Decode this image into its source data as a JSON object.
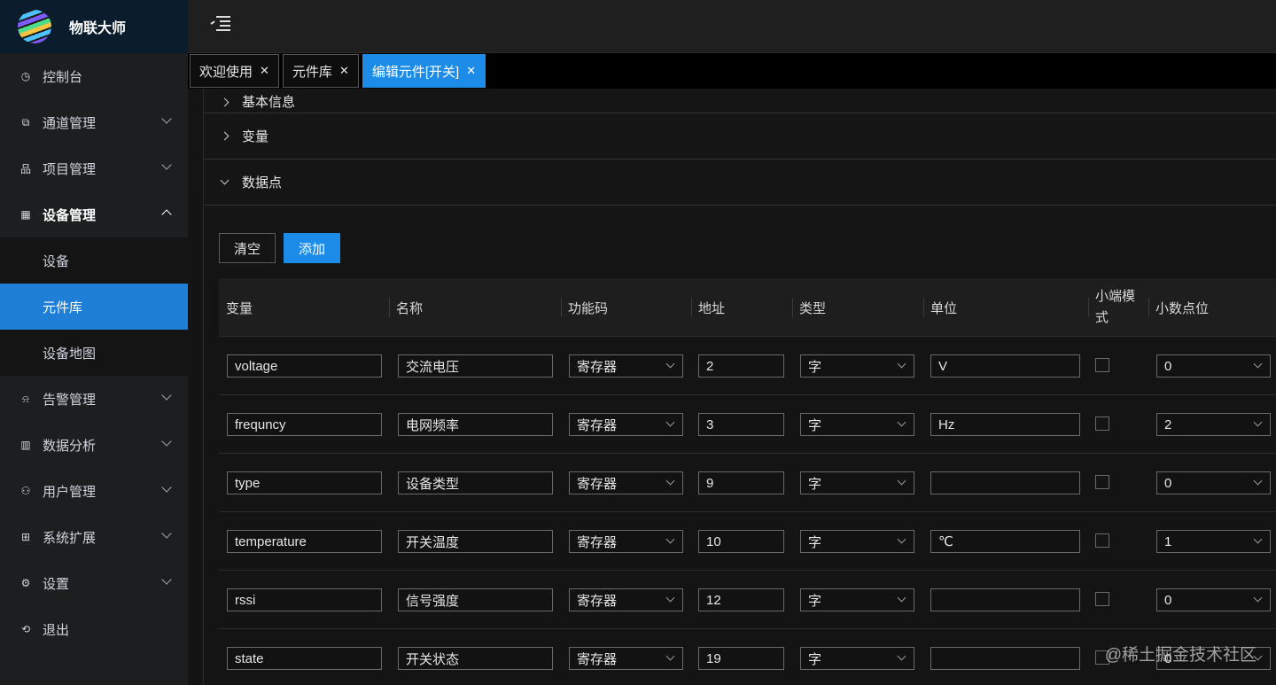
{
  "app": {
    "title": "物联大师"
  },
  "sidebar": {
    "items": [
      {
        "label": "控制台",
        "icon": "dashboard-icon",
        "glyph": "◷",
        "hasArrow": false
      },
      {
        "label": "通道管理",
        "icon": "channel-icon",
        "glyph": "⧉",
        "hasArrow": true
      },
      {
        "label": "项目管理",
        "icon": "project-icon",
        "glyph": "品",
        "hasArrow": true
      },
      {
        "label": "设备管理",
        "icon": "device-icon",
        "glyph": "▦",
        "hasArrow": true,
        "open": true,
        "children": [
          {
            "label": "设备",
            "active": false
          },
          {
            "label": "元件库",
            "active": true
          },
          {
            "label": "设备地图",
            "active": false
          }
        ]
      },
      {
        "label": "告警管理",
        "icon": "bell-icon",
        "glyph": "⍾",
        "hasArrow": true
      },
      {
        "label": "数据分析",
        "icon": "chart-icon",
        "glyph": "▥",
        "hasArrow": true
      },
      {
        "label": "用户管理",
        "icon": "user-icon",
        "glyph": "⚇",
        "hasArrow": true
      },
      {
        "label": "系统扩展",
        "icon": "extension-icon",
        "glyph": "⊞",
        "hasArrow": true
      },
      {
        "label": "设置",
        "icon": "gear-icon",
        "glyph": "⚙",
        "hasArrow": true
      },
      {
        "label": "退出",
        "icon": "logout-icon",
        "glyph": "⟲",
        "hasArrow": false
      }
    ]
  },
  "tabs": [
    {
      "label": "欢迎使用",
      "active": false
    },
    {
      "label": "元件库",
      "active": false
    },
    {
      "label": "编辑元件[开关]",
      "active": true
    }
  ],
  "sections": {
    "basic": "基本信息",
    "variables": "变量",
    "points": "数据点"
  },
  "buttons": {
    "clear": "清空",
    "add": "添加"
  },
  "table": {
    "columns": {
      "variable": "变量",
      "name": "名称",
      "function_code": "功能码",
      "address": "地址",
      "type": "类型",
      "unit": "单位",
      "little_endian": "小端模式",
      "decimals": "小数点位"
    },
    "rows": [
      {
        "variable": "voltage",
        "name": "交流电压",
        "function_code": "寄存器",
        "address": "2",
        "type": "字",
        "unit": "V",
        "little_endian": false,
        "decimals": "0"
      },
      {
        "variable": "frequncy",
        "name": "电网频率",
        "function_code": "寄存器",
        "address": "3",
        "type": "字",
        "unit": "Hz",
        "little_endian": false,
        "decimals": "2"
      },
      {
        "variable": "type",
        "name": "设备类型",
        "function_code": "寄存器",
        "address": "9",
        "type": "字",
        "unit": "",
        "little_endian": false,
        "decimals": "0"
      },
      {
        "variable": "temperature",
        "name": "开关温度",
        "function_code": "寄存器",
        "address": "10",
        "type": "字",
        "unit": "℃",
        "little_endian": false,
        "decimals": "1"
      },
      {
        "variable": "rssi",
        "name": "信号强度",
        "function_code": "寄存器",
        "address": "12",
        "type": "字",
        "unit": "",
        "little_endian": false,
        "decimals": "0"
      },
      {
        "variable": "state",
        "name": "开关状态",
        "function_code": "寄存器",
        "address": "19",
        "type": "字",
        "unit": "",
        "little_endian": false,
        "decimals": "0"
      }
    ]
  },
  "watermark": "@稀土掘金技术社区",
  "colors": {
    "accent": "#1d8ce8",
    "sidebar_active": "#1f7fd6",
    "brand_bg": "#0b1c2c"
  }
}
